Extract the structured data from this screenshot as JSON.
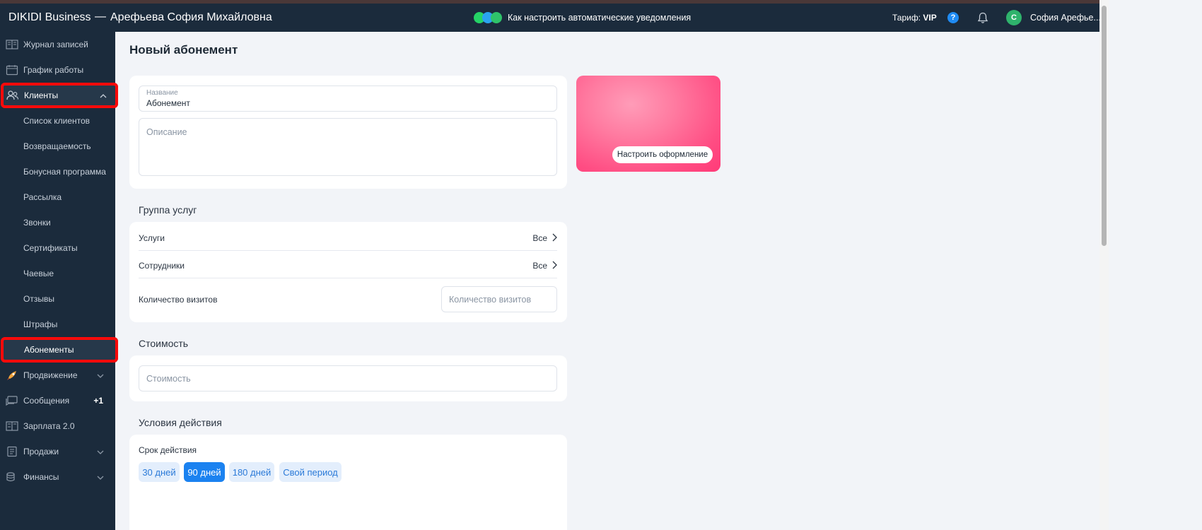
{
  "topbar": {
    "brand": "DIKIDI Business",
    "separator": "—",
    "account_name": "Арефьева София Михайловна",
    "promo_text": "Как настроить автоматические уведомления",
    "tariff_label": "Тариф:",
    "tariff_value": "VIP",
    "help_glyph": "?",
    "avatar_letter": "С",
    "user_name": "София Арефье..."
  },
  "sidebar": {
    "items": [
      {
        "label": "Журнал записей",
        "icon": "journal-icon"
      },
      {
        "label": "График работы",
        "icon": "calendar-icon"
      },
      {
        "label": "Клиенты",
        "icon": "clients-icon"
      },
      {
        "label": "Список клиентов"
      },
      {
        "label": "Возвращаемость"
      },
      {
        "label": "Бонусная программа"
      },
      {
        "label": "Рассылка"
      },
      {
        "label": "Звонки"
      },
      {
        "label": "Сертификаты"
      },
      {
        "label": "Чаевые"
      },
      {
        "label": "Отзывы"
      },
      {
        "label": "Штрафы"
      },
      {
        "label": "Абонементы"
      },
      {
        "label": "Продвижение",
        "icon": "rocket-icon"
      },
      {
        "label": "Сообщения",
        "icon": "messages-icon",
        "badge": "+1"
      },
      {
        "label": "Зарплата 2.0",
        "icon": "salary-icon"
      },
      {
        "label": "Продажи",
        "icon": "sales-icon"
      },
      {
        "label": "Финансы",
        "icon": "finance-icon"
      }
    ]
  },
  "main": {
    "title": "Новый абонемент",
    "name_label": "Название",
    "name_value": "Абонемент",
    "description_placeholder": "Описание",
    "design_button": "Настроить оформление",
    "services_group_title": "Группа услуг",
    "services_label": "Услуги",
    "services_value": "Все",
    "staff_label": "Сотрудники",
    "staff_value": "Все",
    "visits_label": "Количество визитов",
    "visits_placeholder": "Количество визитов",
    "cost_title": "Стоимость",
    "cost_placeholder": "Стоимость",
    "conditions_title": "Условия действия",
    "validity_label": "Срок действия",
    "periods": [
      "30 дней",
      "90 дней",
      "180 дней",
      "Свой период"
    ],
    "selected_period": "90 дней"
  },
  "colors": {
    "topbar_bg": "#1b2b3c",
    "accent": "#1b82f0",
    "highlight": "#ff0a0a",
    "card_gradient": "#ff4d83"
  }
}
